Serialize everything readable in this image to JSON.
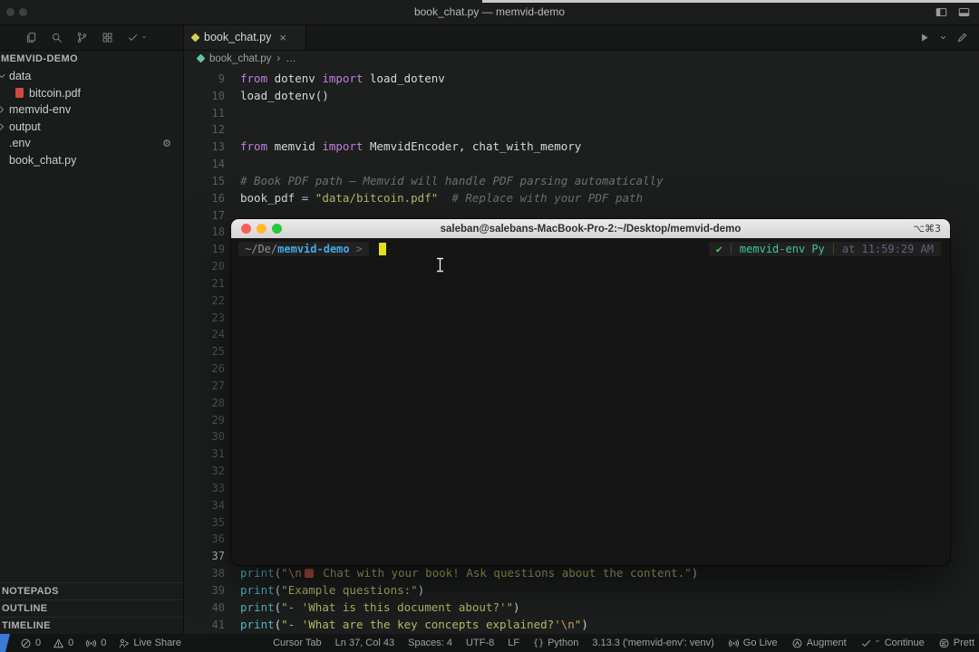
{
  "window": {
    "title": "book_chat.py — memvid-demo"
  },
  "toolbar": {
    "icons": [
      "files",
      "search",
      "source-control",
      "extensions",
      "check"
    ]
  },
  "tab": {
    "label": "book_chat.py",
    "close": "×"
  },
  "breadcrumb": {
    "file": "book_chat.py",
    "sep": "›",
    "more": "…"
  },
  "sidebar": {
    "header": "MEMVID-DEMO",
    "items": [
      {
        "label": "data",
        "icon": "chevron-down",
        "indent": 0
      },
      {
        "label": "bitcoin.pdf",
        "icon": "pdf",
        "indent": 1
      },
      {
        "label": "memvid-env",
        "icon": "chevron-right",
        "indent": 0
      },
      {
        "label": "output",
        "icon": "chevron-right",
        "indent": 0
      },
      {
        "label": ".env",
        "icon": "none",
        "right_icon": "gear",
        "indent": 0
      },
      {
        "label": "book_chat.py",
        "icon": "none",
        "indent": 0
      }
    ],
    "sections": [
      "NOTEPADS",
      "OUTLINE",
      "TIMELINE"
    ]
  },
  "editor": {
    "active_line": "37",
    "lines": [
      {
        "num": "9",
        "tokens": [
          [
            "k",
            "from"
          ],
          [
            "d",
            " dotenv "
          ],
          [
            "k",
            "import"
          ],
          [
            "d",
            " load_dotenv"
          ]
        ]
      },
      {
        "num": "10",
        "tokens": [
          [
            "d",
            "load_dotenv()"
          ]
        ]
      },
      {
        "num": "11",
        "tokens": []
      },
      {
        "num": "12",
        "tokens": []
      },
      {
        "num": "13",
        "tokens": [
          [
            "k",
            "from"
          ],
          [
            "d",
            " memvid "
          ],
          [
            "k",
            "import"
          ],
          [
            "d",
            " MemvidEncoder, chat_with_memory"
          ]
        ]
      },
      {
        "num": "14",
        "tokens": []
      },
      {
        "num": "15",
        "tokens": [
          [
            "c",
            "# Book PDF path — Memvid will handle PDF parsing automatically"
          ]
        ]
      },
      {
        "num": "16",
        "tokens": [
          [
            "d",
            "book_pdf "
          ],
          [
            "o",
            "= "
          ],
          [
            "s",
            "\"data/bitcoin.pdf\""
          ],
          [
            "d",
            "  "
          ],
          [
            "c",
            "# Replace with your PDF path"
          ]
        ]
      },
      {
        "num": "17",
        "tokens": []
      },
      {
        "num": "18",
        "tokens": []
      },
      {
        "num": "19",
        "tokens": []
      },
      {
        "num": "20",
        "tokens": []
      },
      {
        "num": "21",
        "tokens": []
      },
      {
        "num": "22",
        "tokens": []
      },
      {
        "num": "23",
        "tokens": []
      },
      {
        "num": "24",
        "tokens": []
      },
      {
        "num": "25",
        "tokens": []
      },
      {
        "num": "26",
        "tokens": []
      },
      {
        "num": "27",
        "tokens": []
      },
      {
        "num": "28",
        "tokens": []
      },
      {
        "num": "29",
        "tokens": []
      },
      {
        "num": "30",
        "tokens": []
      },
      {
        "num": "31",
        "tokens": []
      },
      {
        "num": "32",
        "tokens": []
      },
      {
        "num": "33",
        "tokens": []
      },
      {
        "num": "34",
        "tokens": []
      },
      {
        "num": "35",
        "tokens": []
      },
      {
        "num": "36",
        "tokens": []
      },
      {
        "num": "37",
        "tokens": []
      },
      {
        "num": "38",
        "tokens": [
          [
            "f",
            "print"
          ],
          [
            "d",
            "("
          ],
          [
            "s",
            "\""
          ],
          [
            "e",
            "\\n"
          ],
          [
            "em",
            "📖"
          ],
          [
            "s",
            " Chat with your book! Ask questions about the content.\""
          ],
          [
            "d",
            ")"
          ]
        ]
      },
      {
        "num": "39",
        "tokens": [
          [
            "f",
            "print"
          ],
          [
            "d",
            "("
          ],
          [
            "s",
            "\"Example questions:\""
          ],
          [
            "d",
            ")"
          ]
        ]
      },
      {
        "num": "40",
        "tokens": [
          [
            "f",
            "print"
          ],
          [
            "d",
            "("
          ],
          [
            "s",
            "\"- 'What is this document about?'\""
          ],
          [
            "d",
            ")"
          ]
        ]
      },
      {
        "num": "41",
        "tokens": [
          [
            "f",
            "print"
          ],
          [
            "d",
            "("
          ],
          [
            "s",
            "\"- 'What are the key concepts explained?'"
          ],
          [
            "e",
            "\\n"
          ],
          [
            "s",
            "\""
          ],
          [
            "d",
            ")"
          ]
        ]
      }
    ]
  },
  "terminal": {
    "title": "saleban@salebans-MacBook-Pro-2:~/Desktop/memvid-demo",
    "shortcut": "⌥⌘3",
    "prompt": {
      "path_dim": "~/De",
      "path_sep": "/",
      "path_main": "memvid-demo",
      "chevron": ">"
    },
    "right": {
      "ok": "✔",
      "venv": "memvid-env Py",
      "time": "at 11:59:29 AM"
    }
  },
  "status_bar": {
    "left": [
      {
        "icon": "error",
        "label": "0"
      },
      {
        "icon": "warning",
        "label": "0"
      },
      {
        "icon": "tower",
        "label": "0"
      },
      {
        "icon": "liveshare",
        "label": "Live Share"
      }
    ],
    "right": [
      {
        "label": "Cursor Tab"
      },
      {
        "label": "Ln 37, Col 43"
      },
      {
        "label": "Spaces: 4"
      },
      {
        "label": "UTF-8"
      },
      {
        "label": "LF"
      },
      {
        "icon": "braces",
        "label": "Python"
      },
      {
        "label": "3.13.3 ('memvid-env': venv)"
      },
      {
        "icon": "tower",
        "label": "Go Live"
      },
      {
        "icon": "augment",
        "label": "Augment"
      },
      {
        "icon": "check",
        "label": "Continue"
      },
      {
        "icon": "prettier",
        "label": "Prett"
      }
    ]
  }
}
